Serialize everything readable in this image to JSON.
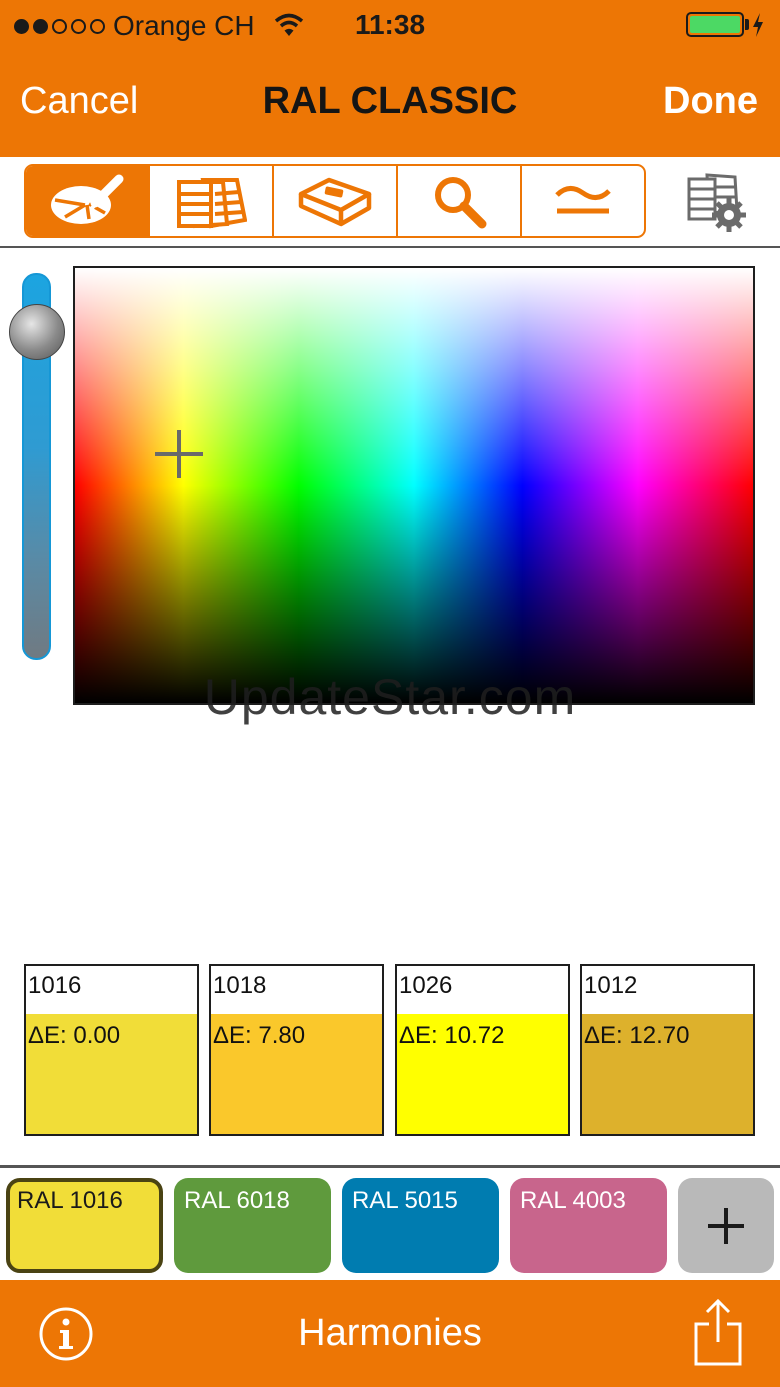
{
  "status_bar": {
    "carrier": "Orange CH",
    "time": "11:38"
  },
  "nav": {
    "cancel_label": "Cancel",
    "title": "RAL CLASSIC",
    "done_label": "Done"
  },
  "toolbar": {
    "tabs": [
      {
        "icon": "color-picker-icon"
      },
      {
        "icon": "color-fan-icon"
      },
      {
        "icon": "eraser-icon"
      },
      {
        "icon": "search-icon"
      },
      {
        "icon": "approximate-icon"
      }
    ],
    "settings_icon": "swatch-settings-icon"
  },
  "watermark": "UpdateStar.com",
  "matches": [
    {
      "code": "1016",
      "delta": "ΔE: 0.00",
      "color": "#f1dd38"
    },
    {
      "code": "1018",
      "delta": "ΔE: 7.80",
      "color": "#fac82b"
    },
    {
      "code": "1026",
      "delta": "ΔE: 10.72",
      "color": "#ffff00"
    },
    {
      "code": "1012",
      "delta": "ΔE: 12.70",
      "color": "#ddb12c"
    }
  ],
  "palette": [
    {
      "label": "RAL 1016",
      "color": "#f1dd38"
    },
    {
      "label": "RAL 6018",
      "color": "#5f9a3d"
    },
    {
      "label": "RAL 5015",
      "color": "#007cb0"
    },
    {
      "label": "RAL 4003",
      "color": "#c8658c"
    }
  ],
  "bottom_bar": {
    "title": "Harmonies"
  },
  "colors": {
    "accent": "#ed7605"
  }
}
